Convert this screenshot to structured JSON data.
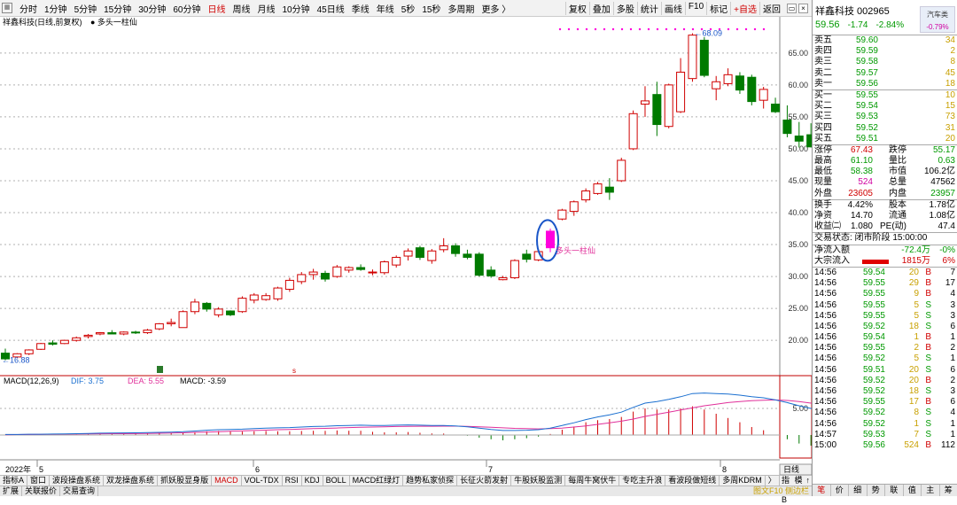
{
  "toolbar": {
    "periods": [
      "分时",
      "1分钟",
      "5分钟",
      "15分钟",
      "30分钟",
      "60分钟",
      "日线",
      "周线",
      "月线",
      "10分钟",
      "45日线",
      "季线",
      "年线",
      "5秒",
      "15秒",
      "多周期",
      "更多 〉"
    ],
    "active_period": "日线",
    "right_tools": [
      "复权",
      "叠加",
      "多股",
      "统计",
      "画线",
      "F10",
      "标记",
      "+自选",
      "返回"
    ]
  },
  "chart": {
    "title": "祥鑫科技(日线,前复权)",
    "pattern_label": "多头一柱仙",
    "high_label": "68.09",
    "low_label": "16.88",
    "callout_label": "多头一柱仙",
    "price_axis": [
      "65.00",
      "60.00",
      "55.00",
      "50.00",
      "45.00",
      "40.00",
      "35.00",
      "30.00",
      "25.00",
      "20.00"
    ],
    "macd_header": {
      "name": "MACD(12,26,9)",
      "dif": "DIF: 3.75",
      "dea": "DEA: 5.55",
      "macd": "MACD: -3.59"
    },
    "macd_axis": "5.00",
    "date_labels": [
      "2022年",
      "5",
      "6",
      "7",
      "8"
    ],
    "date_tab": "日线",
    "colors": {
      "up": "#d00000",
      "down": "#007a00",
      "dif": "#1a6fd0",
      "dea": "#e0309a",
      "highlight": "#ff00dd"
    }
  },
  "chart_data": {
    "type": "candlestick",
    "ylim": [
      16,
      69
    ],
    "ohlc": [
      [
        18.0,
        18.7,
        16.88,
        17.1
      ],
      [
        17.4,
        18.0,
        17.2,
        17.9
      ],
      [
        17.9,
        18.6,
        17.7,
        18.5
      ],
      [
        18.6,
        19.6,
        18.5,
        19.5
      ],
      [
        19.6,
        20.0,
        19.2,
        19.4
      ],
      [
        19.5,
        20.1,
        19.4,
        20.0
      ],
      [
        20.0,
        20.6,
        19.8,
        20.4
      ],
      [
        20.6,
        21.0,
        20.3,
        20.8
      ],
      [
        21.0,
        21.3,
        20.8,
        21.2
      ],
      [
        21.2,
        21.6,
        21.0,
        21.0
      ],
      [
        21.0,
        21.4,
        20.8,
        21.3
      ],
      [
        21.3,
        21.5,
        21.0,
        21.2
      ],
      [
        21.2,
        21.8,
        21.0,
        21.6
      ],
      [
        21.8,
        22.7,
        21.6,
        22.6
      ],
      [
        22.6,
        23.4,
        22.2,
        22.8
      ],
      [
        22.0,
        24.7,
        22.0,
        24.5
      ],
      [
        24.5,
        26.5,
        24.1,
        26.0
      ],
      [
        25.8,
        26.0,
        24.5,
        24.9
      ],
      [
        24.0,
        25.2,
        23.6,
        24.9
      ],
      [
        24.6,
        24.7,
        23.8,
        24.0
      ],
      [
        24.5,
        26.9,
        24.3,
        26.6
      ],
      [
        26.3,
        27.4,
        25.8,
        27.1
      ],
      [
        26.4,
        27.4,
        26.2,
        27.0
      ],
      [
        26.5,
        28.4,
        26.2,
        28.2
      ],
      [
        28.0,
        29.8,
        27.6,
        29.4
      ],
      [
        29.2,
        30.7,
        28.8,
        30.3
      ],
      [
        30.3,
        31.2,
        29.5,
        30.7
      ],
      [
        30.5,
        30.9,
        29.2,
        29.6
      ],
      [
        30.0,
        31.8,
        29.8,
        31.5
      ],
      [
        31.0,
        31.6,
        30.6,
        31.4
      ],
      [
        31.4,
        31.9,
        30.9,
        31.1
      ],
      [
        30.6,
        31.1,
        30.2,
        30.7
      ],
      [
        30.6,
        32.5,
        30.3,
        32.3
      ],
      [
        31.8,
        33.3,
        31.4,
        33.0
      ],
      [
        33.2,
        34.4,
        32.5,
        34.0
      ],
      [
        34.5,
        34.8,
        32.6,
        33.0
      ],
      [
        32.5,
        34.3,
        32.0,
        34.0
      ],
      [
        34.2,
        36.0,
        33.8,
        34.8
      ],
      [
        34.8,
        35.2,
        33.1,
        33.6
      ],
      [
        33.5,
        34.2,
        32.7,
        33.0
      ],
      [
        33.5,
        33.8,
        30.0,
        30.2
      ],
      [
        31.0,
        31.6,
        29.8,
        30.1
      ],
      [
        29.5,
        30.1,
        29.4,
        29.8
      ],
      [
        29.8,
        32.7,
        29.6,
        32.5
      ],
      [
        33.5,
        34.2,
        32.2,
        32.7
      ],
      [
        32.6,
        34.2,
        32.4,
        33.9
      ],
      [
        34.5,
        37.5,
        33.8,
        37.1
      ],
      [
        39.0,
        40.6,
        38.8,
        40.4
      ],
      [
        40.2,
        41.9,
        39.5,
        41.7
      ],
      [
        42.0,
        43.8,
        41.6,
        43.4
      ],
      [
        43.0,
        44.8,
        42.8,
        44.5
      ],
      [
        44.0,
        45.4,
        42.0,
        43.2
      ],
      [
        45.0,
        48.6,
        44.8,
        48.2
      ],
      [
        50.0,
        56.0,
        49.8,
        55.5
      ],
      [
        57.0,
        59.8,
        55.0,
        57.5
      ],
      [
        58.5,
        60.5,
        52.0,
        53.8
      ],
      [
        53.5,
        60.2,
        53.2,
        60.0
      ],
      [
        55.8,
        64.2,
        55.6,
        62.0
      ],
      [
        61.0,
        68.09,
        60.5,
        67.8
      ],
      [
        67.0,
        67.5,
        61.2,
        61.5
      ],
      [
        59.4,
        61.4,
        57.6,
        60.5
      ],
      [
        60.2,
        62.6,
        59.8,
        61.6
      ],
      [
        61.4,
        62.0,
        58.6,
        59.2
      ],
      [
        61.2,
        61.6,
        56.8,
        57.4
      ],
      [
        57.6,
        59.7,
        56.3,
        59.3
      ],
      [
        57.0,
        58.0,
        55.6,
        55.8
      ],
      [
        54.5,
        56.8,
        51.8,
        52.4
      ],
      [
        52.0,
        54.2,
        50.2,
        51.2
      ],
      [
        52.2,
        54.0,
        50.2,
        50.3
      ],
      [
        49.6,
        49.8,
        49.2,
        49.3
      ],
      [
        50.7,
        54.5,
        48.4,
        54.3
      ]
    ],
    "highlight_index": 46,
    "macd": {
      "ylim": [
        -4,
        9
      ],
      "dif": [
        0.1,
        0.1,
        0.15,
        0.15,
        0.18,
        0.2,
        0.25,
        0.3,
        0.35,
        0.38,
        0.4,
        0.42,
        0.45,
        0.5,
        0.55,
        0.62,
        0.75,
        0.9,
        1.0,
        1.05,
        1.1,
        1.2,
        1.3,
        1.35,
        1.4,
        1.5,
        1.6,
        1.65,
        1.75,
        1.8,
        1.85,
        1.8,
        1.8,
        1.85,
        1.9,
        1.85,
        1.8,
        1.8,
        1.7,
        1.55,
        1.3,
        1.05,
        0.85,
        0.85,
        0.9,
        1.0,
        1.3,
        1.8,
        2.3,
        2.9,
        3.4,
        3.8,
        4.3,
        5.2,
        6.0,
        6.3,
        6.7,
        7.2,
        7.8,
        7.9,
        7.8,
        7.7,
        7.5,
        7.2,
        7.0,
        6.6,
        6.1,
        5.5,
        5.0,
        4.5,
        4.3
      ],
      "dea": [
        0.05,
        0.08,
        0.1,
        0.12,
        0.14,
        0.16,
        0.18,
        0.2,
        0.22,
        0.24,
        0.26,
        0.28,
        0.3,
        0.34,
        0.38,
        0.42,
        0.5,
        0.55,
        0.62,
        0.7,
        0.78,
        0.85,
        0.92,
        1.0,
        1.05,
        1.12,
        1.2,
        1.26,
        1.32,
        1.4,
        1.45,
        1.5,
        1.55,
        1.6,
        1.62,
        1.64,
        1.65,
        1.66,
        1.66,
        1.62,
        1.55,
        1.45,
        1.35,
        1.25,
        1.2,
        1.15,
        1.2,
        1.3,
        1.5,
        1.7,
        2.0,
        2.3,
        2.6,
        3.0,
        3.5,
        3.9,
        4.3,
        4.7,
        5.1,
        5.5,
        5.8,
        6.1,
        6.3,
        6.45,
        6.55,
        6.6,
        6.5,
        6.3,
        6.0,
        5.8,
        5.55
      ]
    }
  },
  "bottom_tabs": [
    "指标A",
    "窗口",
    "波段操盘系统",
    "双龙操盘系统",
    "抓妖股显身版",
    "MACD",
    "VOL-TDX",
    "RSI",
    "KDJ",
    "BOLL",
    "MACD红绿灯",
    "趋势私家侦探",
    "长征火箭发射",
    "牛股妖股监测",
    "每周牛窝伏牛",
    "专吃主升浪",
    "看波段做短线",
    "多周KDRM",
    "〉"
  ],
  "active_bottom_tab": "MACD",
  "bottom_tabs_right": [
    "指标B",
    "模板",
    "↑"
  ],
  "footer_tabs": [
    "扩展",
    "关联报价",
    "交易查询"
  ],
  "footer_note": "图文F10 侧边栏",
  "quote": {
    "name_code": "祥鑫科技 002965",
    "price": "59.56",
    "change": "-1.74",
    "change_pct": "-2.84%",
    "sector_name": "汽车类",
    "sector_pct": "-0.79%",
    "asks": [
      [
        "卖五",
        "59.60",
        "34"
      ],
      [
        "卖四",
        "59.59",
        "2"
      ],
      [
        "卖三",
        "59.58",
        "8"
      ],
      [
        "卖二",
        "59.57",
        "45"
      ],
      [
        "卖一",
        "59.56",
        "18"
      ]
    ],
    "bids": [
      [
        "买一",
        "59.55",
        "10"
      ],
      [
        "买二",
        "59.54",
        "15"
      ],
      [
        "买三",
        "59.53",
        "73"
      ],
      [
        "买四",
        "59.52",
        "31"
      ],
      [
        "买五",
        "59.51",
        "20"
      ]
    ],
    "stats": [
      [
        "涨停",
        "67.43",
        "r",
        "跌停",
        "55.17",
        "g"
      ],
      [
        "最高",
        "61.10",
        "g",
        "量比",
        "0.63",
        "g"
      ],
      [
        "最低",
        "58.38",
        "g",
        "市值",
        "106.2亿",
        "k"
      ],
      [
        "现量",
        "524",
        "m",
        "总量",
        "47562",
        "k"
      ],
      [
        "外盘",
        "23605",
        "r",
        "内盘",
        "23957",
        "g"
      ]
    ],
    "stats2": [
      [
        "换手",
        "4.42%",
        "k",
        "股本",
        "1.78亿",
        "k"
      ],
      [
        "净资",
        "14.70",
        "k",
        "流通",
        "1.08亿",
        "k"
      ],
      [
        "收益㈡",
        "1.080",
        "k",
        "PE(动)",
        "47.4",
        "k"
      ]
    ],
    "trade_status": "交易状态: 闭市阶段 15:00:00",
    "flow": [
      [
        "净流入额",
        "-72.4万",
        "-0%"
      ],
      [
        "大宗流入",
        "1815万",
        "6%"
      ]
    ],
    "ticks": [
      [
        "14:56",
        "59.54",
        "20",
        "B",
        "7"
      ],
      [
        "14:56",
        "59.55",
        "29",
        "B",
        "17"
      ],
      [
        "14:56",
        "59.55",
        "9",
        "B",
        "4"
      ],
      [
        "14:56",
        "59.55",
        "5",
        "S",
        "3"
      ],
      [
        "14:56",
        "59.55",
        "5",
        "S",
        "3"
      ],
      [
        "14:56",
        "59.52",
        "18",
        "S",
        "6"
      ],
      [
        "14:56",
        "59.54",
        "1",
        "B",
        "1"
      ],
      [
        "14:56",
        "59.55",
        "2",
        "B",
        "2"
      ],
      [
        "14:56",
        "59.52",
        "5",
        "S",
        "1"
      ],
      [
        "14:56",
        "59.51",
        "20",
        "S",
        "6"
      ],
      [
        "14:56",
        "59.52",
        "20",
        "B",
        "2"
      ],
      [
        "14:56",
        "59.52",
        "18",
        "S",
        "3"
      ],
      [
        "14:56",
        "59.55",
        "17",
        "B",
        "6"
      ],
      [
        "14:56",
        "59.52",
        "8",
        "S",
        "4"
      ],
      [
        "14:56",
        "59.52",
        "1",
        "S",
        "1"
      ],
      [
        "14:57",
        "59.53",
        "7",
        "S",
        "1"
      ],
      [
        "15:00",
        "59.56",
        "524",
        "B",
        "112"
      ]
    ],
    "footer": [
      "笔",
      "价",
      "细",
      "势",
      "联",
      "值",
      "主",
      "筹"
    ]
  }
}
